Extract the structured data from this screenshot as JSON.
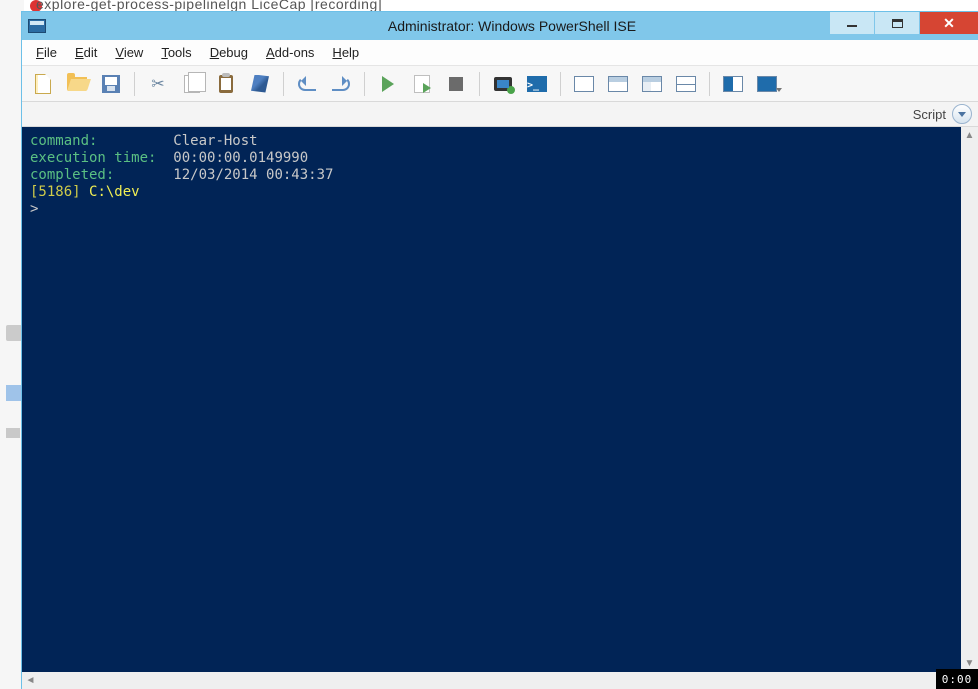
{
  "background": {
    "partial_title": "explore-get-process-pipelinelgn    LiceCap [recording]"
  },
  "window": {
    "title": "Administrator: Windows PowerShell ISE",
    "controls": {
      "minimize": "–",
      "maximize": "❐",
      "close": "✕"
    }
  },
  "menu": {
    "file": "File",
    "edit": "Edit",
    "view": "View",
    "tools": "Tools",
    "debug": "Debug",
    "addons": "Add-ons",
    "help": "Help"
  },
  "toolbar": {
    "new": "New",
    "open": "Open",
    "save": "Save",
    "cut": "Cut",
    "copy": "Copy",
    "paste": "Paste",
    "clear": "Clear",
    "undo": "Undo",
    "redo": "Redo",
    "run": "Run Script",
    "runsel": "Run Selection",
    "stop": "Stop",
    "remote": "New Remote PowerShell Tab",
    "pstab": "Start PowerShell.exe",
    "pane_a": "Show Script Pane Top",
    "pane_b": "Show Script Pane Right",
    "pane_c": "Show Script Pane Maximized",
    "pane_d": "Show Console",
    "pspane1": "Show Command Add-on",
    "pspane2": "Show Command Add-on 2",
    "ps_glyph": ">_"
  },
  "scriptstrip": {
    "label": "Script"
  },
  "console": {
    "labels": {
      "command": "command:         ",
      "exectime": "execution time:  ",
      "completed": "completed:       "
    },
    "values": {
      "command": "Clear-Host",
      "exectime": "00:00:00.0149990",
      "completed": "12/03/2014 00:43:37"
    },
    "history_id": "[5186]",
    "path": "C:\\dev",
    "prompt": ">"
  },
  "recorder": {
    "time": "0:00"
  }
}
